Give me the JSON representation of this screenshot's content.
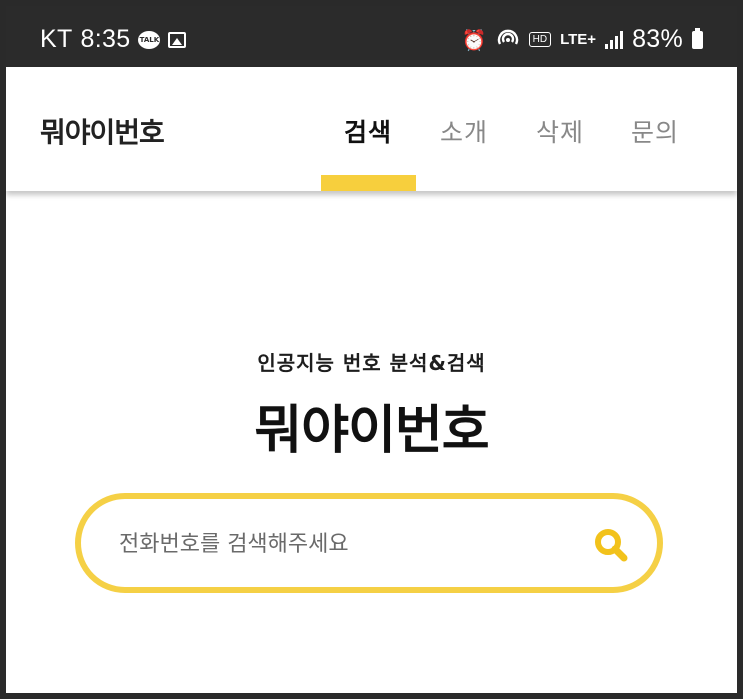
{
  "status_bar": {
    "carrier": "KT",
    "time": "8:35",
    "talk_badge": "TALK",
    "hd_badge": "HD",
    "network": "LTE+",
    "battery_percent": "83%"
  },
  "header": {
    "logo": "뭐야이번호",
    "tabs": [
      {
        "label": "검색",
        "active": true
      },
      {
        "label": "소개",
        "active": false
      },
      {
        "label": "삭제",
        "active": false
      },
      {
        "label": "문의",
        "active": false
      }
    ]
  },
  "hero": {
    "subtitle": "인공지능 번호 분석&검색",
    "title": "뭐야이번호"
  },
  "search": {
    "placeholder": "전화번호를 검색해주세요",
    "value": ""
  },
  "colors": {
    "accent": "#f7cf3d",
    "status_bar_bg": "#2b2b2b"
  }
}
